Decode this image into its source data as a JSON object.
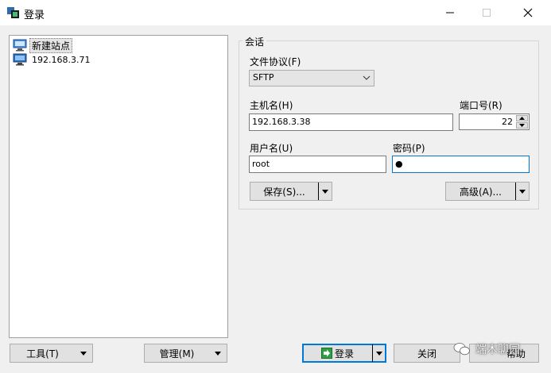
{
  "window": {
    "title": "登录"
  },
  "sites": [
    {
      "label": "新建站点",
      "selected": true,
      "icon": "new-site-icon"
    },
    {
      "label": "192.168.3.71",
      "selected": false,
      "icon": "computer-icon"
    }
  ],
  "session": {
    "group_title": "会话",
    "protocol_label": "文件协议(F)",
    "protocol_value": "SFTP",
    "host_label": "主机名(H)",
    "host_value": "192.168.3.38",
    "port_label": "端口号(R)",
    "port_value": "22",
    "user_label": "用户名(U)",
    "user_value": "root",
    "password_label": "密码(P)",
    "password_value": "●",
    "save_button": "保存(S)...",
    "advanced_button": "高级(A)..."
  },
  "footer": {
    "tools_button": "工具(T)",
    "manage_button": "管理(M)",
    "login_button": "登录",
    "close_button": "关闭",
    "help_button": "帮助"
  },
  "watermark": "端木聊园",
  "colors": {
    "accent": "#0078d7",
    "button_bg": "#e1e1e1",
    "window_bg": "#f0f0f0"
  }
}
